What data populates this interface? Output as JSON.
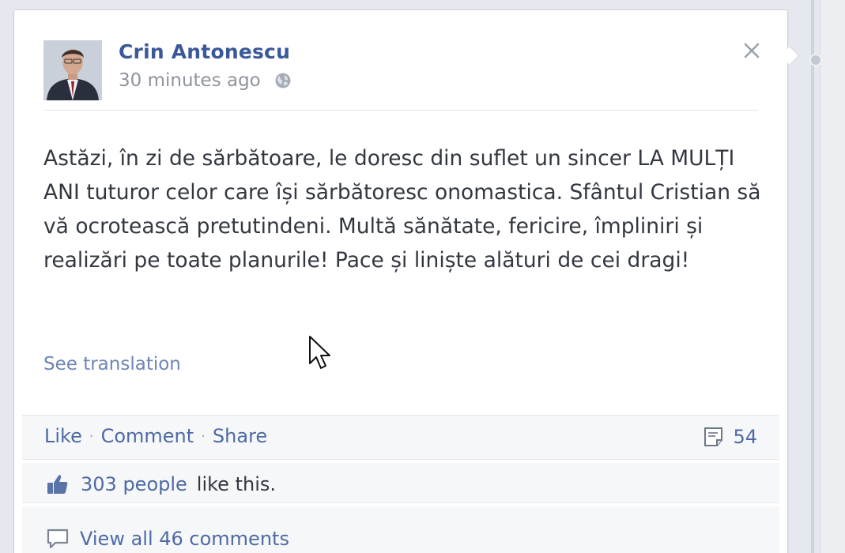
{
  "post": {
    "author": "Crin Antonescu",
    "timestamp": "30 minutes ago",
    "privacy_icon": "globe-icon",
    "text": "Astăzi, în zi de sărbătoare, le doresc din suflet un sincer LA MULȚI ANI tuturor celor care își sărbătoresc onomastica. Sfântul Cristian să vă ocrotească pretutindeni. Multă sănătate, fericire, împliniri și realizări pe toate planurile! Pace și liniște alături de cei dragi!",
    "see_translation": "See translation"
  },
  "actions": {
    "like": "Like",
    "comment": "Comment",
    "share": "Share",
    "separator": "·"
  },
  "comment_count": "54",
  "likes": {
    "link": "303 people",
    "suffix": "like this."
  },
  "comments": {
    "view_all": "View all 46 comments"
  },
  "colors": {
    "link": "#3b5998",
    "text": "#333840",
    "muted": "#90949c",
    "panel": "#f6f7f9"
  }
}
